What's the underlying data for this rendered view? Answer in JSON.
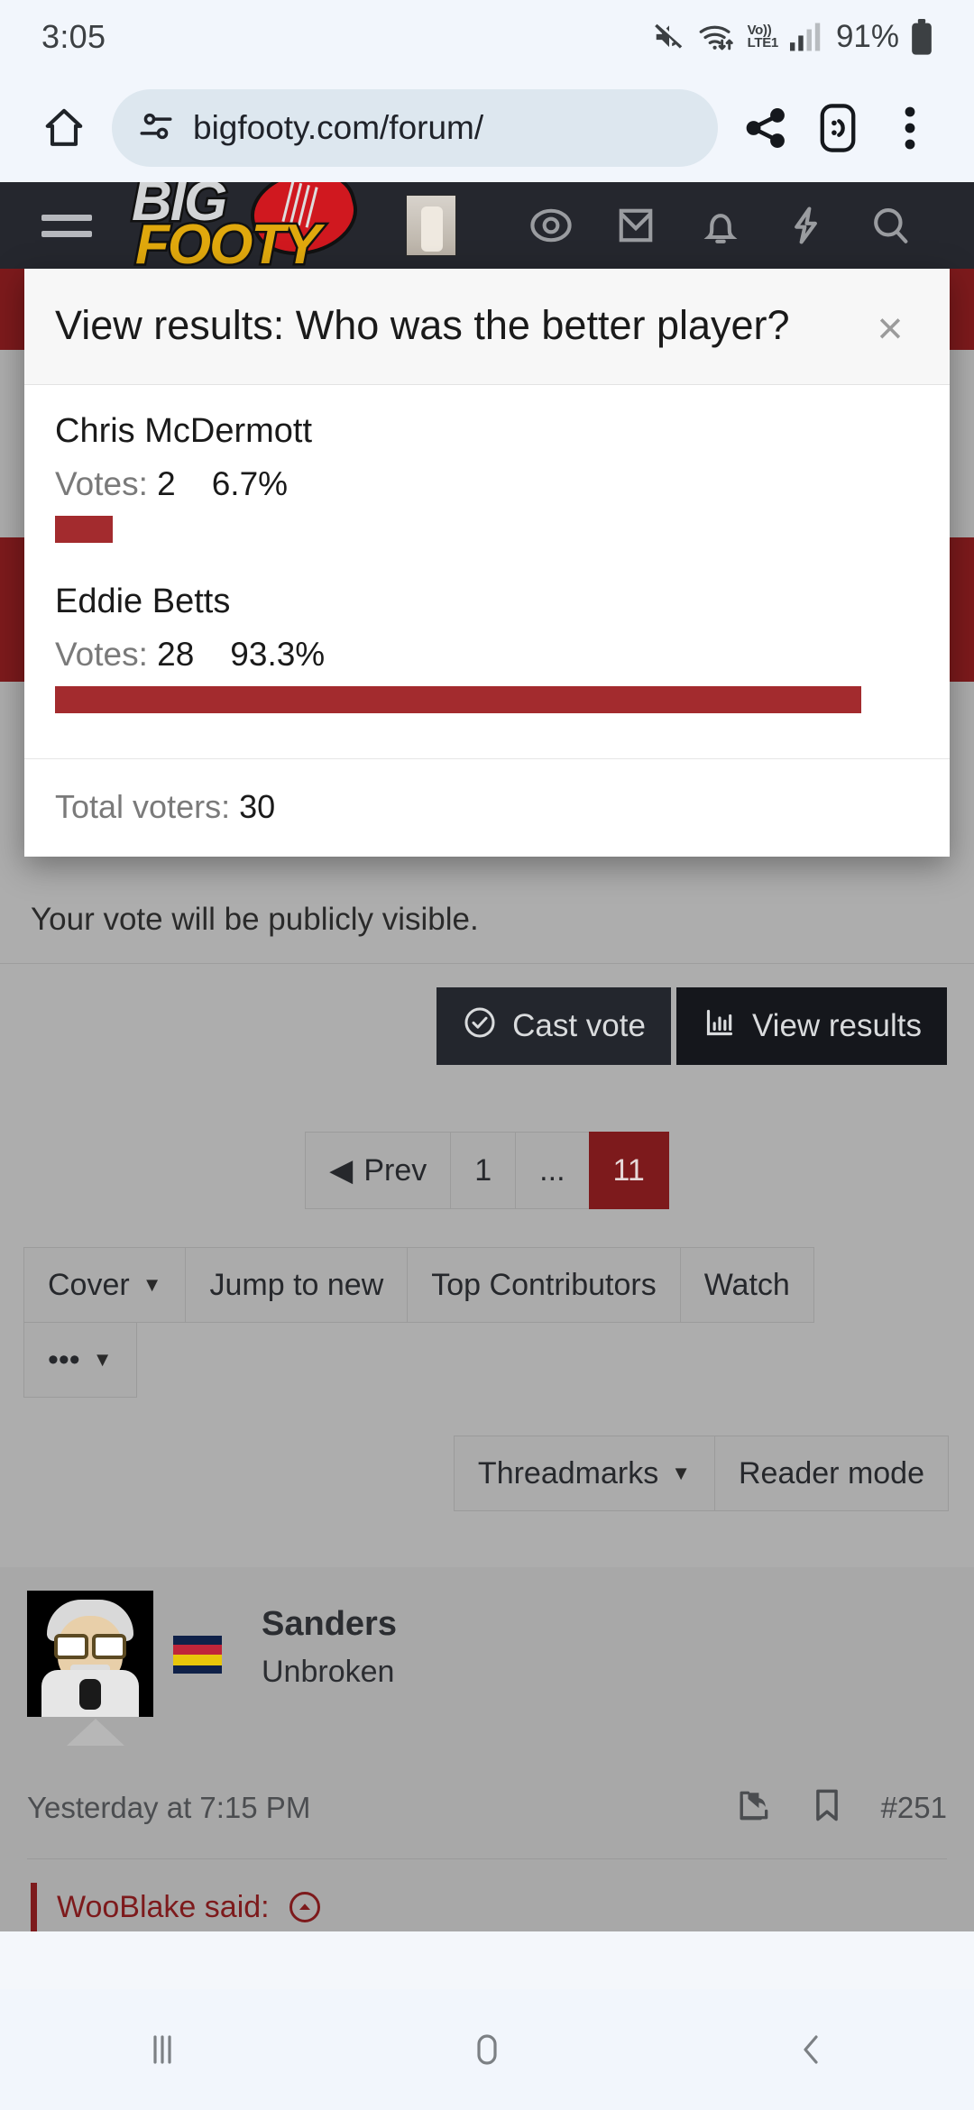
{
  "status_bar": {
    "time": "3:05",
    "network_label": "Vo))",
    "network_label2": "LTE1",
    "battery_percent": "91%",
    "icons": [
      "mute-icon",
      "wifi-icon",
      "volte-icon",
      "signal-icon",
      "battery-icon"
    ]
  },
  "browser": {
    "url": "bigfooty.com/forum/",
    "home_icon": "home-icon",
    "site_settings_icon": "tune-icon",
    "share_icon": "share-icon",
    "profile_icon": ":D",
    "menu_icon": "overflow-menu-icon"
  },
  "site_header": {
    "logo_part1": "BIG",
    "logo_part2": "FOOTY",
    "menu_icon": "hamburger-icon",
    "icons": [
      "eye-icon",
      "envelope-icon",
      "bell-icon",
      "bolt-icon",
      "search-icon"
    ]
  },
  "modal": {
    "title": "View results: Who was the better player?",
    "close_label": "×",
    "total_label": "Total voters:",
    "total_value": "30",
    "options": [
      {
        "name": "Chris McDermott",
        "votes_label": "Votes:",
        "votes": "2",
        "percent": "6.7%",
        "bar_width": 6.7
      },
      {
        "name": "Eddie Betts",
        "votes_label": "Votes:",
        "votes": "28",
        "percent": "93.3%",
        "bar_width": 93.3
      }
    ]
  },
  "chart_data": {
    "type": "bar",
    "title": "View results: Who was the better player?",
    "categories": [
      "Chris McDermott",
      "Eddie Betts"
    ],
    "values": [
      2,
      28
    ],
    "percentages": [
      6.7,
      93.3
    ],
    "total": 30,
    "xlabel": "",
    "ylabel": "Votes",
    "orientation": "horizontal",
    "bar_color": "#a32b2e"
  },
  "poll": {
    "note": "Your vote will be publicly visible.",
    "cast_vote_label": "Cast vote",
    "view_results_label": "View results",
    "cast_vote_icon": "check-circle-icon",
    "view_results_icon": "bar-chart-icon"
  },
  "pagination": {
    "prev_label": "Prev",
    "pages": [
      "1",
      "...",
      "11"
    ],
    "active_page": "11"
  },
  "toolbar_primary": [
    {
      "label": "Cover",
      "has_caret": true
    },
    {
      "label": "Jump to new",
      "has_caret": false
    },
    {
      "label": "Top Contributors",
      "has_caret": false
    },
    {
      "label": "Watch",
      "has_caret": false
    }
  ],
  "toolbar_more": {
    "label": "•••",
    "has_caret": true
  },
  "toolbar_secondary": [
    {
      "label": "Threadmarks",
      "has_caret": true
    },
    {
      "label": "Reader mode",
      "has_caret": false
    }
  ],
  "post": {
    "username": "Sanders",
    "user_title": "Unbroken",
    "date": "Yesterday at 7:15 PM",
    "post_number": "#251",
    "share_icon": "share-post-icon",
    "bookmark_icon": "bookmark-icon",
    "avatar_icon": "user-avatar",
    "flag_icon": "team-flag-badge",
    "quote_text": "WooBlake said:"
  },
  "nav_bar": {
    "recents": "recents-icon",
    "home": "home-icon",
    "back": "back-icon"
  },
  "colors": {
    "accent_red": "#a32b2e",
    "dark_red": "#7d1a1c",
    "header_dark": "#25272e",
    "chrome_bg": "#f2f6fc"
  }
}
